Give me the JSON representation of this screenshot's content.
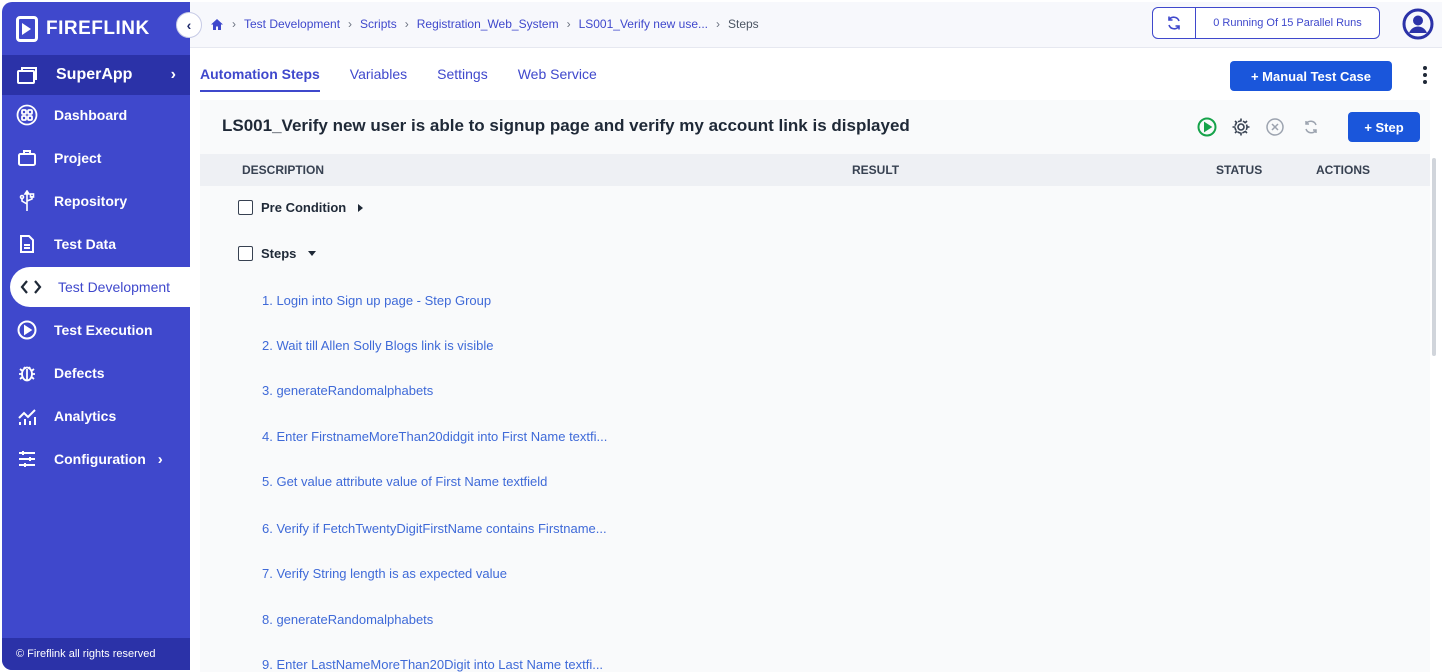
{
  "app": {
    "brand": "FIREFLINK",
    "footer": "© Fireflink all rights reserved"
  },
  "sidebar": {
    "superapp": "SuperApp",
    "items": [
      {
        "label": "Dashboard",
        "icon": "dashboard-icon"
      },
      {
        "label": "Project",
        "icon": "briefcase-icon"
      },
      {
        "label": "Repository",
        "icon": "usb-icon"
      },
      {
        "label": "Test Data",
        "icon": "document-icon"
      },
      {
        "label": "Test Development",
        "icon": "code-icon",
        "active": true
      },
      {
        "label": "Test Execution",
        "icon": "play-circle-icon"
      },
      {
        "label": "Defects",
        "icon": "bug-icon"
      },
      {
        "label": "Analytics",
        "icon": "analytics-icon"
      },
      {
        "label": "Configuration",
        "icon": "sliders-icon"
      }
    ]
  },
  "breadcrumb": [
    "Test Development",
    "Scripts",
    "Registration_Web_System",
    "LS001_Verify new use...",
    "Steps"
  ],
  "header": {
    "runs": "0 Running Of 15 Parallel Runs"
  },
  "tabs": [
    "Automation Steps",
    "Variables",
    "Settings",
    "Web Service"
  ],
  "buttons": {
    "manual_test_case": "+ Manual Test Case",
    "add_step": "+ Step"
  },
  "script": {
    "title": "LS001_Verify new user is able to signup page and verify my account link is displayed"
  },
  "table": {
    "headers": [
      "DESCRIPTION",
      "RESULT",
      "STATUS",
      "ACTIONS"
    ],
    "groups": {
      "pre_condition": "Pre Condition",
      "steps": "Steps"
    },
    "steps": [
      "1. Login into Sign up page - Step Group",
      "2. Wait till Allen Solly Blogs link is visible",
      "3. generateRandomalphabets",
      "4. Enter FirstnameMoreThan20didgit into First Name textfi...",
      "5. Get value attribute value of First Name textfield",
      "6. Verify if FetchTwentyDigitFirstName contains Firstname...",
      "7. Verify String length is as expected value",
      "8. generateRandomalphabets",
      "9. Enter LastNameMoreThan20Digit into Last Name textfi..."
    ]
  },
  "colors": {
    "sidebar": "#3f48cc",
    "primary_button": "#1a56db",
    "link": "#3f6ad8",
    "run_green": "#16a34a"
  }
}
